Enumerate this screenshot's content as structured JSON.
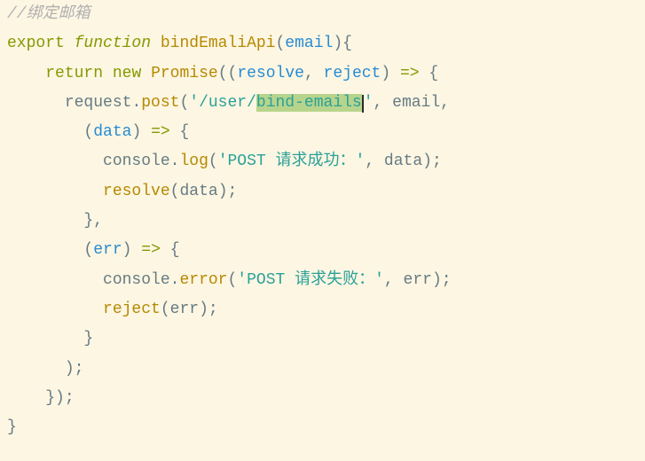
{
  "code": {
    "comment": "//绑定邮箱",
    "kw_export": "export",
    "kw_function": "function",
    "fn_name": "bindEmaliApi",
    "param_email": "email",
    "kw_return": "return",
    "kw_new": "new",
    "cls_promise": "Promise",
    "param_resolve": "resolve",
    "param_reject": "reject",
    "arrow": "=>",
    "var_request": "request",
    "fn_post": "post",
    "str_url_pre": "'/user/",
    "str_url_hl": "bind-emails",
    "str_url_post": "'",
    "param_data": "data",
    "var_console": "console",
    "fn_log": "log",
    "str_log": "'POST 请求成功：'",
    "fn_resolve_call": "resolve",
    "param_err": "err",
    "fn_error": "error",
    "str_err": "'POST 请求失败：'",
    "fn_reject_call": "reject",
    "comma": ",",
    "comma_sp": ", ",
    "semi": ";",
    "lp": "(",
    "rp": ")",
    "lb": "{",
    "rb": "}",
    "dot": "."
  }
}
